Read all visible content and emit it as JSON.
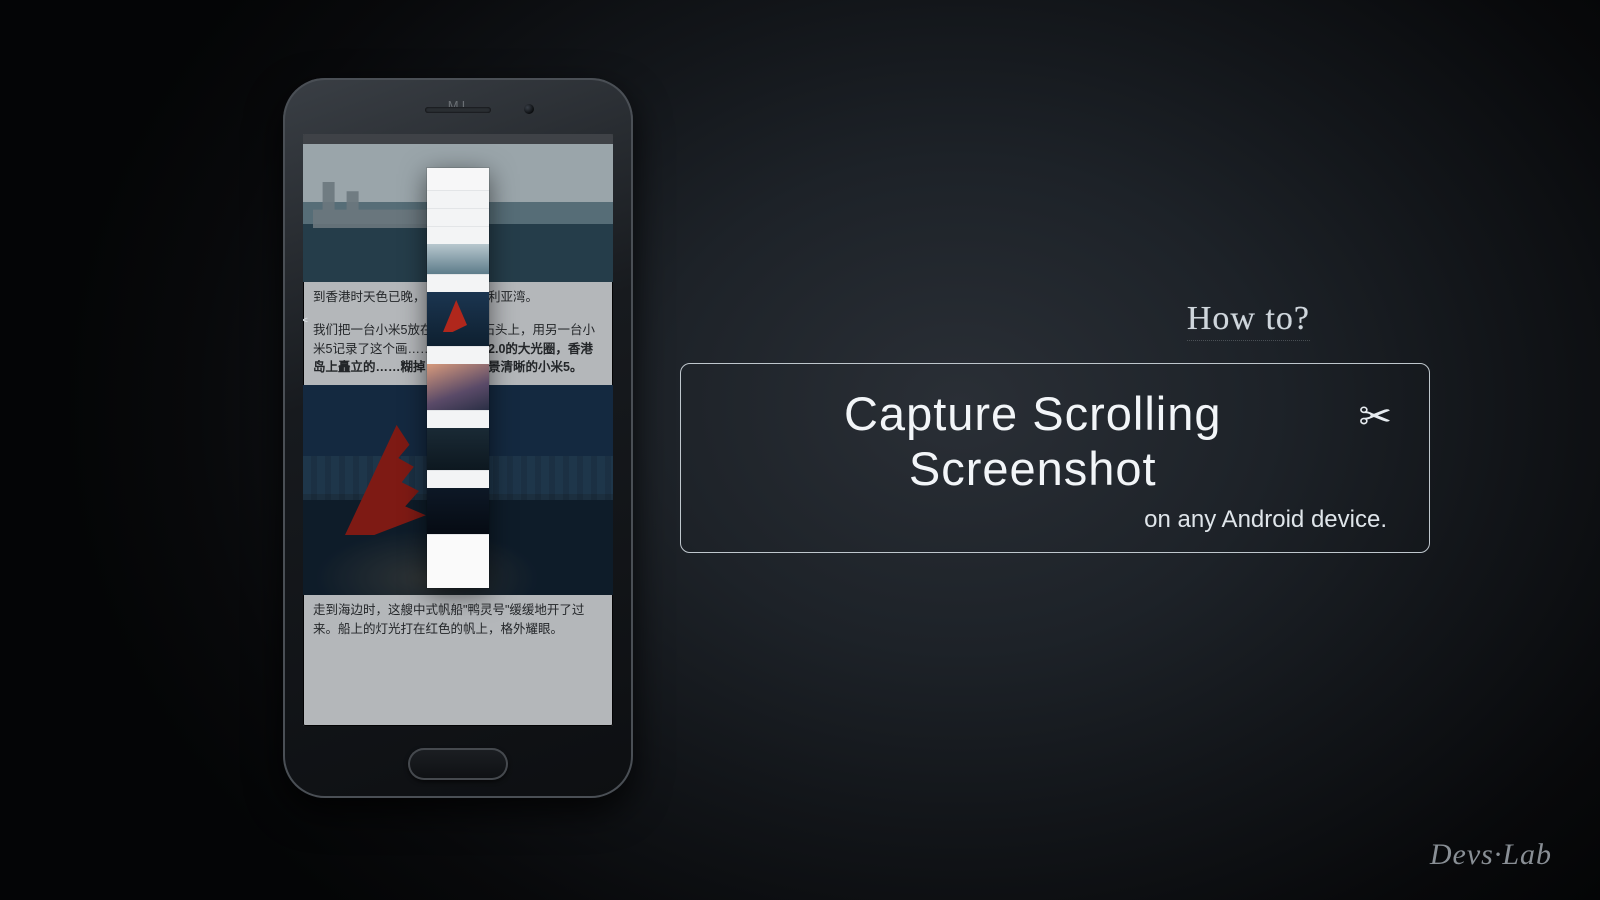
{
  "text": {
    "howto": "How to?",
    "title_main": "Capture Scrolling Screenshot",
    "scissors_glyph": "✂",
    "title_sub": "on any Android device.",
    "watermark": "Devs·Lab"
  },
  "phone": {
    "brand": "MI",
    "article": {
      "caption1": "到香港时天色已晚，……入维多利亚湾。",
      "body1_prefix": "我们把一台小米5放在……顶的石头上，用另一台小米5记录了这个画……",
      "body1_bold": "米5拥有F2.0的大光圈，香港岛上矗立的……糊掉，只剩下前景清晰的小米5。",
      "caption2": "走到海边时，这艘中式帆船\"鸭灵号\"缓缓地开了过来。船上的灯光打在红色的帆上，格外耀眼。"
    },
    "scissors_glyph": "✂"
  }
}
